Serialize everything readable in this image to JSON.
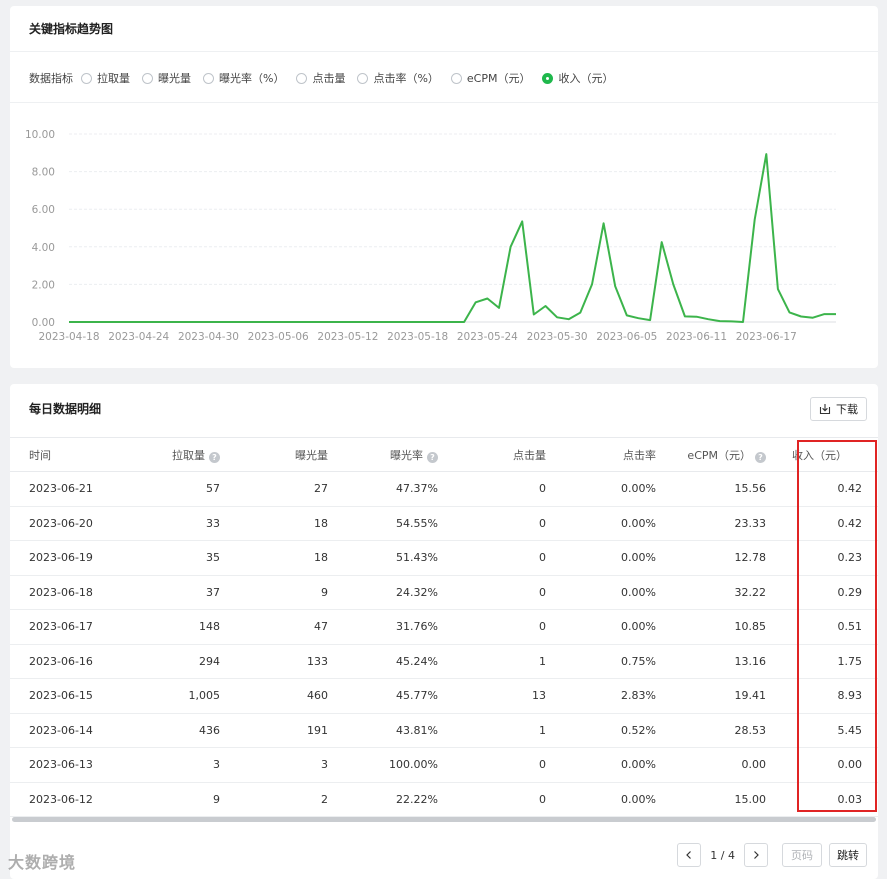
{
  "trend": {
    "title": "关键指标趋势图",
    "metric_label": "数据指标",
    "metrics": [
      {
        "label": "拉取量",
        "selected": false
      },
      {
        "label": "曝光量",
        "selected": false
      },
      {
        "label": "曝光率（%）",
        "selected": false
      },
      {
        "label": "点击量",
        "selected": false
      },
      {
        "label": "点击率（%）",
        "selected": false
      },
      {
        "label": "eCPM（元）",
        "selected": false
      },
      {
        "label": "收入（元）",
        "selected": true
      }
    ]
  },
  "chart_data": {
    "type": "line",
    "title": "",
    "xlabel": "",
    "ylabel": "",
    "ylim": [
      0,
      10
    ],
    "yticks": [
      "10.00",
      "8.00",
      "6.00",
      "4.00",
      "2.00",
      "0.00"
    ],
    "xtick_labels": [
      "2023-04-18",
      "2023-04-24",
      "2023-04-30",
      "2023-05-06",
      "2023-05-12",
      "2023-05-18",
      "2023-05-24",
      "2023-05-30",
      "2023-06-05",
      "2023-06-11",
      "2023-06-17"
    ],
    "grid": true,
    "line_color": "#3cb44b",
    "start_date": "2023-04-18",
    "series": [
      {
        "name": "收入（元）",
        "values": [
          0,
          0,
          0,
          0,
          0,
          0,
          0,
          0,
          0,
          0,
          0,
          0,
          0,
          0,
          0,
          0,
          0,
          0,
          0,
          0,
          0,
          0,
          0,
          0,
          0,
          0,
          0,
          0,
          0,
          0,
          0,
          0,
          0,
          0,
          0,
          1.05,
          1.25,
          0.75,
          4.0,
          5.35,
          0.4,
          0.85,
          0.25,
          0.15,
          0.5,
          2.0,
          5.25,
          1.9,
          0.35,
          0.2,
          0.1,
          4.25,
          2.0,
          0.3,
          0.28,
          0.15,
          0.05,
          0.03,
          0.0,
          5.45,
          8.93,
          1.75,
          0.51,
          0.29,
          0.23,
          0.42,
          0.42
        ]
      }
    ]
  },
  "daily": {
    "title": "每日数据明细",
    "download_label": "下载",
    "columns": [
      "时间",
      "拉取量",
      "曝光量",
      "曝光率",
      "点击量",
      "点击率",
      "eCPM（元）",
      "收入（元）"
    ],
    "rows": [
      [
        "2023-06-21",
        "57",
        "27",
        "47.37%",
        "0",
        "0.00%",
        "15.56",
        "0.42"
      ],
      [
        "2023-06-20",
        "33",
        "18",
        "54.55%",
        "0",
        "0.00%",
        "23.33",
        "0.42"
      ],
      [
        "2023-06-19",
        "35",
        "18",
        "51.43%",
        "0",
        "0.00%",
        "12.78",
        "0.23"
      ],
      [
        "2023-06-18",
        "37",
        "9",
        "24.32%",
        "0",
        "0.00%",
        "32.22",
        "0.29"
      ],
      [
        "2023-06-17",
        "148",
        "47",
        "31.76%",
        "0",
        "0.00%",
        "10.85",
        "0.51"
      ],
      [
        "2023-06-16",
        "294",
        "133",
        "45.24%",
        "1",
        "0.75%",
        "13.16",
        "1.75"
      ],
      [
        "2023-06-15",
        "1,005",
        "460",
        "45.77%",
        "13",
        "2.83%",
        "19.41",
        "8.93"
      ],
      [
        "2023-06-14",
        "436",
        "191",
        "43.81%",
        "1",
        "0.52%",
        "28.53",
        "5.45"
      ],
      [
        "2023-06-13",
        "3",
        "3",
        "100.00%",
        "0",
        "0.00%",
        "0.00",
        "0.00"
      ],
      [
        "2023-06-12",
        "9",
        "2",
        "22.22%",
        "0",
        "0.00%",
        "15.00",
        "0.03"
      ]
    ],
    "pager": {
      "info": "1 / 4",
      "page_placeholder": "页码",
      "jump_label": "跳转"
    }
  },
  "watermark": "大数跨境"
}
